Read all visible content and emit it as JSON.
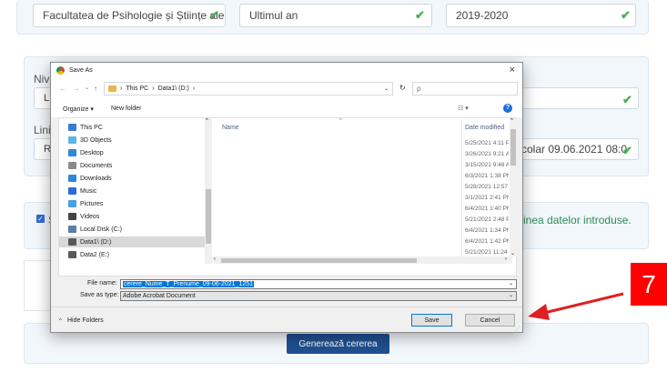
{
  "form": {
    "faculty_value": "Facultatea de Psihologie și Științe ale",
    "year_value": "Ultimul an",
    "academic_year_value": "2019-2020",
    "level_label": "Nive",
    "level_value": "LIC",
    "line_label": "Linia",
    "line_value": "RO",
    "line_suffix_value": "colar 09.06.2021 08:0",
    "confirm_text_start": "S",
    "confirm_text_end": "inea datelor introduse.",
    "generate_button": "Generează cererea"
  },
  "dialog": {
    "title": "Save As",
    "close": "×",
    "nav": {
      "back": "←",
      "forward": "→",
      "up": "↑",
      "breadcrumb": [
        "This PC",
        "Data1\\ (D:)"
      ],
      "search_placeholder": "ρ"
    },
    "toolbar": {
      "organize": "Organize ▾",
      "new_folder": "New folder"
    },
    "tree": [
      {
        "label": "This PC",
        "icon": "computer-icon",
        "color": "#3a7bd5"
      },
      {
        "label": "3D Objects",
        "icon": "3d-objects-icon",
        "color": "#59b7e8"
      },
      {
        "label": "Desktop",
        "icon": "desktop-icon",
        "color": "#2d89d8"
      },
      {
        "label": "Documents",
        "icon": "documents-icon",
        "color": "#8a8a8a"
      },
      {
        "label": "Downloads",
        "icon": "download-icon",
        "color": "#2d89d8"
      },
      {
        "label": "Music",
        "icon": "music-icon",
        "color": "#2d6bd8"
      },
      {
        "label": "Pictures",
        "icon": "pictures-icon",
        "color": "#4aa0e0"
      },
      {
        "label": "Videos",
        "icon": "videos-icon",
        "color": "#444444"
      },
      {
        "label": "Local Disk (C:)",
        "icon": "disk-icon",
        "color": "#5a7fa8"
      },
      {
        "label": "Data1\\ (D:)",
        "icon": "disk-icon",
        "color": "#5a5a5a"
      },
      {
        "label": "Data2 (E:)",
        "icon": "disk-icon",
        "color": "#5a5a5a"
      }
    ],
    "columns": {
      "name": "Name",
      "date_modified": "Date modified"
    },
    "dates": [
      "5/25/2021 4:11 P",
      "3/26/2021 9:21 A",
      "3/15/2021 9:48 A",
      "6/3/2021 1:38 PN",
      "5/28/2021 12:57 I",
      "3/1/2021 2:41 PN",
      "6/4/2021 1:40 PN",
      "5/21/2021 2:48 P",
      "6/4/2021 1:34 PN",
      "6/4/2021 1:42 PN",
      "5/21/2021 11:24"
    ],
    "file_name_label": "File name:",
    "file_name_value": "cerere_Nume_T_Prenume_09-06-2021_1251",
    "save_type_label": "Save as type:",
    "save_type_value": "Adobe Acrobat Document",
    "hide_folders": "Hide Folders",
    "save_button": "Save",
    "cancel_button": "Cancel"
  },
  "annotation": {
    "step_number": "7",
    "badge_color": "#ff0000",
    "arrow_color": "#e02020"
  }
}
